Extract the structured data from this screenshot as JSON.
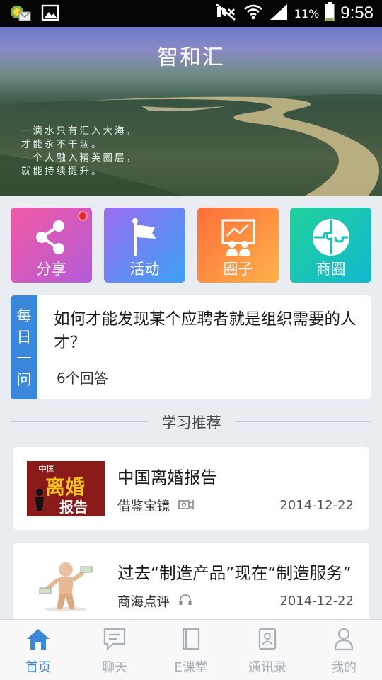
{
  "status_bar": {
    "battery_percent": "11%",
    "time": "9:58"
  },
  "header": {
    "title": "智和汇",
    "banner_caption": [
      "一滴水只有汇入大海，",
      "才能永不干涸。",
      "一个人融入精英圈层，",
      "就能持续提升。"
    ]
  },
  "quick_actions": [
    {
      "label": "分享",
      "icon": "share-icon",
      "has_badge": true
    },
    {
      "label": "活动",
      "icon": "flag-icon",
      "has_badge": false
    },
    {
      "label": "圈子",
      "icon": "presentation-board-icon",
      "has_badge": false
    },
    {
      "label": "商圈",
      "icon": "puzzle-icon",
      "has_badge": false
    }
  ],
  "daily_question": {
    "tag": [
      "每",
      "日",
      "一",
      "问"
    ],
    "question": "如何才能发现某个应聘者就是组织需要的人才？",
    "answers": "6个回答"
  },
  "section": {
    "title": "学习推荐"
  },
  "recommendations": [
    {
      "title": "中国离婚报告",
      "source": "借鉴宝镜",
      "media_icon": "video-icon",
      "date": "2014-12-22",
      "thumb_text": [
        "中国",
        "离婚",
        "报告"
      ]
    },
    {
      "title": "过去“制造产品”现在“制造服务”",
      "source": "商海点评",
      "media_icon": "headphones-icon",
      "date": "2014-12-22"
    }
  ],
  "bottom_nav": [
    {
      "label": "首页",
      "icon": "home-icon",
      "active": true
    },
    {
      "label": "聊天",
      "icon": "chat-icon",
      "active": false
    },
    {
      "label": "E课堂",
      "icon": "book-icon",
      "active": false
    },
    {
      "label": "通讯录",
      "icon": "contacts-icon",
      "active": false
    },
    {
      "label": "我的",
      "icon": "user-icon",
      "active": false
    }
  ],
  "colors": {
    "accent": "#3a88db",
    "nav_inactive": "#a7afb8",
    "badge": "#e0282f"
  }
}
